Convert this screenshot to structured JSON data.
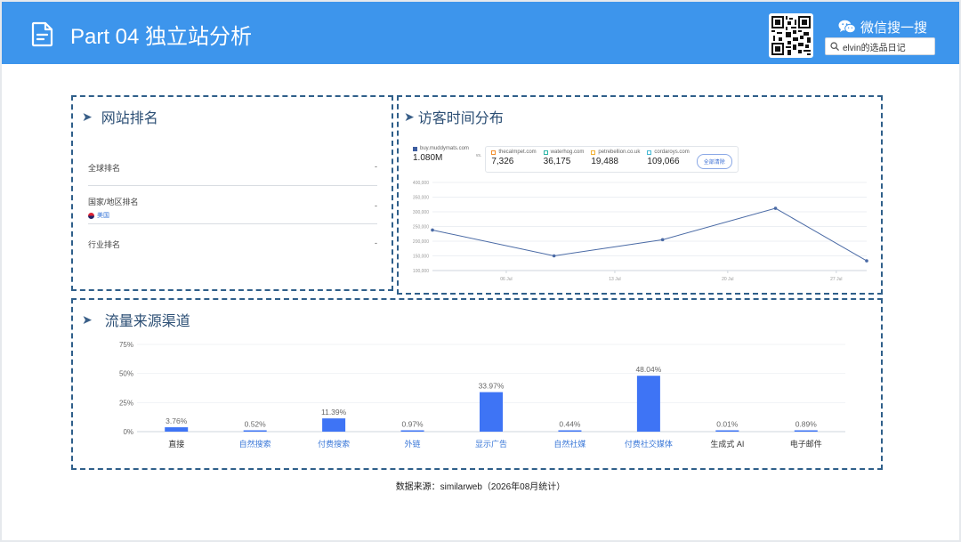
{
  "header": {
    "title": "Part 04 独立站分析",
    "wechat_label": "微信搜一搜",
    "search_text": "elvin的选品日记",
    "icons": [
      "document-icon",
      "qr-code",
      "wechat-icon",
      "search-icon"
    ],
    "bg_color": "#3d95ec"
  },
  "rank": {
    "heading": "网站排名",
    "rows": [
      {
        "label": "全球排名",
        "value": "-"
      },
      {
        "label": "国家/地区排名",
        "value": "-",
        "country": "美国"
      },
      {
        "label": "行业排名",
        "value": "-"
      }
    ]
  },
  "visits": {
    "heading": "访客时间分布",
    "legend": [
      {
        "name": "buy.muddymats.com",
        "value": "1.080M",
        "color": "#3d5da0"
      },
      {
        "name": "thecalmpet.com",
        "value": "7,326",
        "color": "#f28e2c"
      },
      {
        "name": "waterhog.com",
        "value": "36,175",
        "color": "#2cb5a6"
      },
      {
        "name": "petrebellion.co.uk",
        "value": "19,488",
        "color": "#f2b134"
      },
      {
        "name": "cordaroys.com",
        "value": "109,066",
        "color": "#45b8d3"
      }
    ],
    "vs_label": "vs.",
    "compare_button": "全部清除"
  },
  "traffic": {
    "heading": "流量来源渠道"
  },
  "footer": {
    "source": "数据来源：similarweb（2026年08月统计）"
  },
  "chart_data": [
    {
      "type": "line",
      "x": [
        "",
        "06 Jul",
        "13 Jul",
        "20 Jul",
        "27 Jul",
        ""
      ],
      "series": [
        {
          "name": "buy.muddymats.com",
          "values": [
            238000,
            150000,
            205000,
            312000,
            133000
          ]
        }
      ],
      "point_x_fraction": [
        0.0,
        0.28,
        0.53,
        0.79,
        1.0
      ],
      "y_ticks": [
        "400,000",
        "350,000",
        "300,000",
        "250,000",
        "200,000",
        "150,000",
        "100,000"
      ],
      "ylim": [
        100000,
        400000
      ],
      "x_tick_labels": [
        "06 Jul",
        "13 Jul",
        "20 Jul",
        "27 Jul"
      ],
      "grid": true,
      "color": "#4a6aa5"
    },
    {
      "type": "bar",
      "categories": [
        "直接",
        "自然搜索",
        "付费搜索",
        "外链",
        "显示广告",
        "自然社媒",
        "付费社交媒体",
        "生成式 AI",
        "电子邮件"
      ],
      "values": [
        3.76,
        0.52,
        11.39,
        0.97,
        33.97,
        0.44,
        48.04,
        0.01,
        0.89
      ],
      "value_labels": [
        "3.76%",
        "0.52%",
        "11.39%",
        "0.97%",
        "33.97%",
        "0.44%",
        "48.04%",
        "0.01%",
        "0.89%"
      ],
      "y_ticks": [
        "75%",
        "50%",
        "25%",
        "0%"
      ],
      "ylim": [
        0,
        75
      ],
      "bar_color": "#3e74f5",
      "category_label_colors": [
        "#333333",
        "#3b78d8",
        "#3b78d8",
        "#3b78d8",
        "#3b78d8",
        "#3b78d8",
        "#3b78d8",
        "#333333",
        "#333333"
      ],
      "grid": true
    }
  ]
}
